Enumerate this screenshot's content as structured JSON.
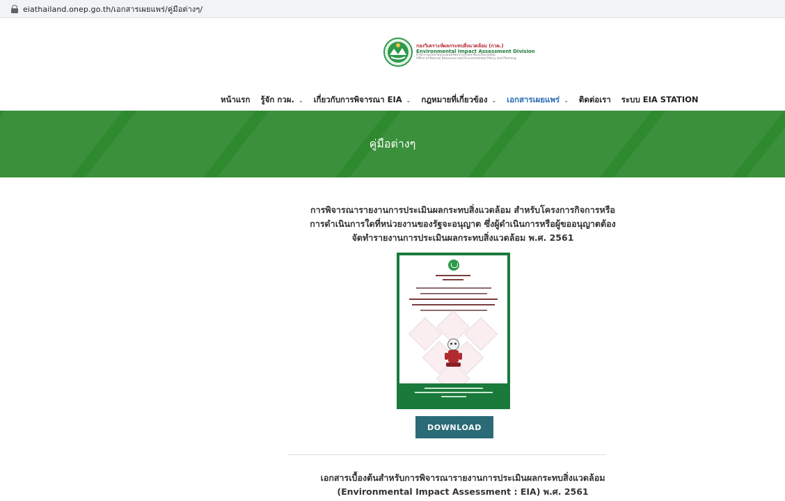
{
  "browser": {
    "url": "eiathailand.onep.go.th/เอกสารเผยแพร่/คู่มือต่างๆ/"
  },
  "logo": {
    "title_th": "กองวิเคราะห์ผลกระทบสิ่งแวดล้อม (กวผ.)",
    "title_en": "Environmental Impact Assessment Division",
    "sub_th": "สำนักงานนโยบายและแผนทรัพยากรธรรมชาติและสิ่งแวดล้อม",
    "sub_en": "Office of Natural Resources and Environmental Policy and Planning"
  },
  "nav": {
    "items": [
      {
        "label": "หน้าแรก"
      },
      {
        "label": "รู้จัก กวผ.",
        "dropdown": true
      },
      {
        "label": "เกี่ยวกับการพิจารณา EIA",
        "dropdown": true
      },
      {
        "label": "กฎหมายที่เกี่ยวข้อง",
        "dropdown": true
      },
      {
        "label": "เอกสารเผยแพร่",
        "dropdown": true,
        "active": true
      },
      {
        "label": "ติดต่อเรา"
      },
      {
        "label": "ระบบ EIA STATION"
      }
    ],
    "chevron_icon": "chevron-down-icon",
    "active_color": "#2b6cb5"
  },
  "banner": {
    "title": "คู่มือต่างๆ",
    "color": "#2f8a2f"
  },
  "section1": {
    "title_lines": [
      "การพิจารณารายงานการประเมินผลกระทบสิ่งแวดล้อม สำหรับโครงการกิจการหรือ",
      "การดำเนินการใดที่หน่วยงานของรัฐจะอนุญาต ซึ่งผู้ดำเนินการหรือผู้ขออนุญาตต้อง",
      "จัดทำรายงานการประเมินผลกระทบสิ่งแวดล้อม พ.ศ. 2561"
    ],
    "download_label": "DOWNLOAD",
    "button_color": "#2b6b78"
  },
  "section2": {
    "title_lines": [
      "เอกสารเบื้องต้นสำหรับการพิจารณารายงานการประเมินผลกระทบสิ่งแวดล้อม",
      "(Environmental Impact Assessment : EIA) พ.ศ. 2561"
    ]
  }
}
